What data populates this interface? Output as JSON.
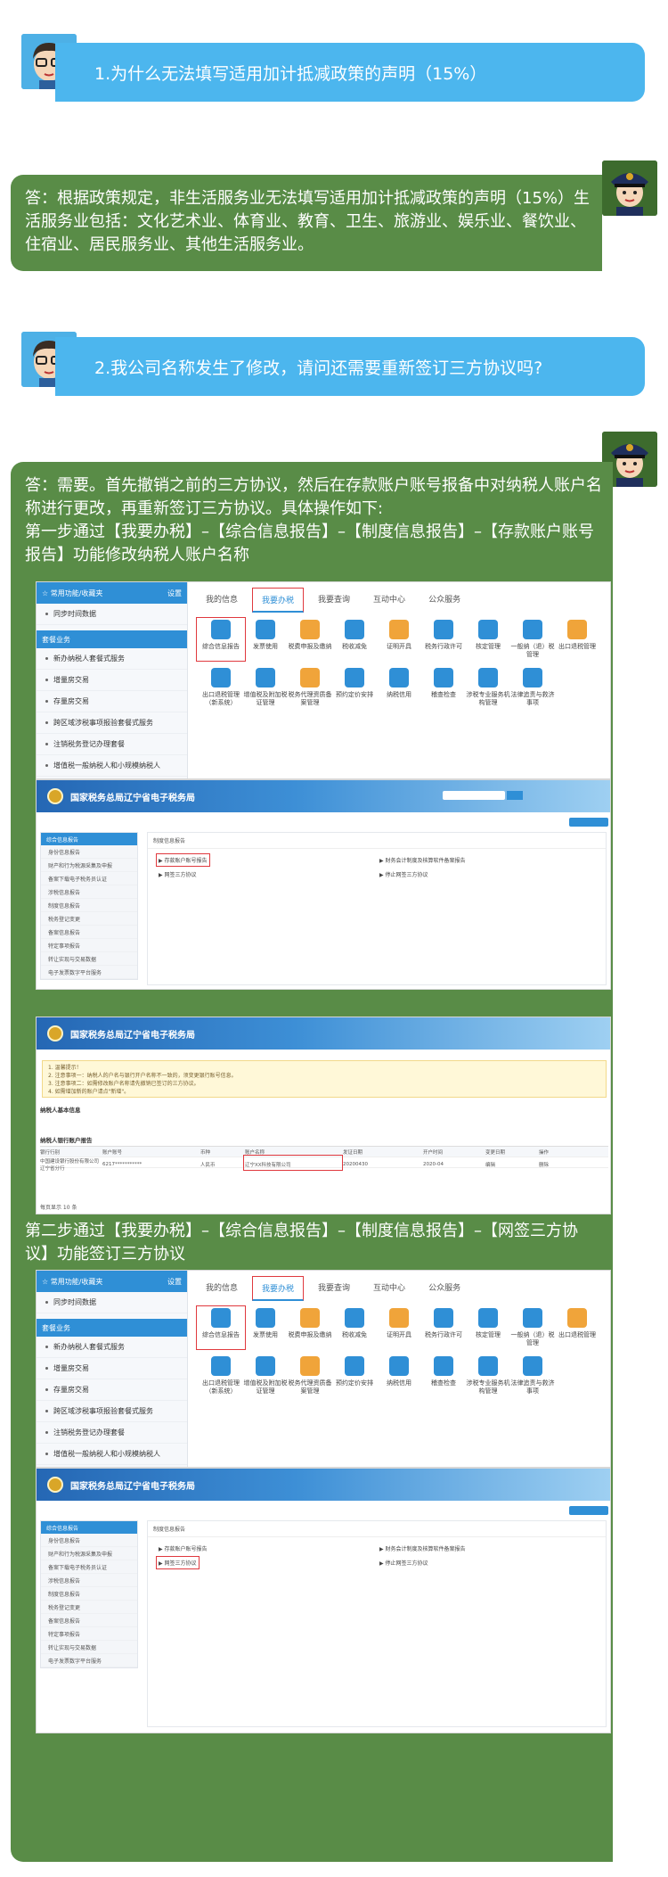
{
  "qa": [
    {
      "question": "1.为什么无法填写适用加计抵减政策的声明（15%）",
      "answer": "答：根据政策规定，非生活服务业无法填写适用加计抵减政策的声明（15%）生活服务业包括：文化艺术业、体育业、教育、卫生、旅游业、娱乐业、餐饮业、住宿业、居民服务业、其他生活服务业。"
    },
    {
      "question": "2.我公司名称发生了修改，请问还需要重新签订三方协议吗?",
      "answer": "答：需要。首先撤销之前的三方协议，然后在存款账户账号报备中对纳税人账户名称进行更改，再重新签订三方协议。具体操作如下:",
      "step1": "第一步通过【我要办税】–【综合信息报告】–【制度信息报告】–【存款账户账号报告】功能修改纳税人账户名称",
      "step2": "第二步通过【我要办税】–【综合信息报告】–【制度信息报告】–【网签三方协议】功能签订三方协议"
    }
  ],
  "panel": {
    "sidebar_header": "常用功能/收藏夹",
    "sidebar_setting": "设置",
    "sidebar_top_item": "同步时间数据",
    "sidebar_section": "套餐业务",
    "sidebar_items": [
      "新办纳税人套餐式服务",
      "增量房交易",
      "存量房交易",
      "跨区域涉税事项报验套餐式服务",
      "注销税务登记办理套餐",
      "增值税一般纳税人和小规模纳税人"
    ],
    "tabs": [
      "我的信息",
      "我要办税",
      "我要查询",
      "互动中心",
      "公众服务"
    ],
    "icons_row1": [
      "综合信息报告",
      "发票使用",
      "税费申报及缴纳",
      "税收减免",
      "证明开具",
      "税务行政许可",
      "核定管理",
      "一般纳（退）税管理",
      "出口退税管理"
    ],
    "icons_row2": [
      "出口退税管理（新系统）",
      "增值税及附加税证管理",
      "税务代理资质备案管理",
      "预约定价安排",
      "纳税信用",
      "稽查检查",
      "涉税专业服务机构管理",
      "法律追责与救济事项"
    ]
  },
  "portal": {
    "title": "国家税务总局辽宁省电子税务局",
    "left_header": "综合信息报告",
    "left_items": [
      "身份信息报告",
      "财产和行为税源采集及申报",
      "备案下载电子税务员认证",
      "涉税信息报告",
      "制度信息报告",
      "税务登记变更",
      "备案信息报告",
      "特定事项报告",
      "转让实现与交易数据",
      "电子发票数字平台服务"
    ],
    "main_title": "制度信息报告",
    "links": [
      "存款账户账号报告",
      "财务会计制度及核算软件备案报告",
      "网签三方协议",
      "停止网签三方协议"
    ],
    "notice": [
      "1. 温馨提示！",
      "2. 注意事项一：纳税人的户名与银行开户名称不一致的，须变更银行账号信息。",
      "3. 注意事项二：如需修改账户名称请先撤销已签订的三方协议。",
      "4. 如需增加新的账户请点\"新增\"。"
    ],
    "section_basic": "纳税人基本信息",
    "section_bank": "纳税人银行账户报告",
    "bank_headers": [
      "银行行别",
      "账户账号",
      "币种",
      "账户名称",
      "发证日期",
      "开户时间",
      "变更日期",
      "操作"
    ],
    "bank_row": [
      "中国建设银行股份有限公司辽宁省分行",
      "6217***********",
      "人民币",
      "辽宁XX科技有限公司",
      "20200430",
      "2020-04",
      "编辑",
      "删除"
    ],
    "footer": "每页显示 10 条"
  }
}
